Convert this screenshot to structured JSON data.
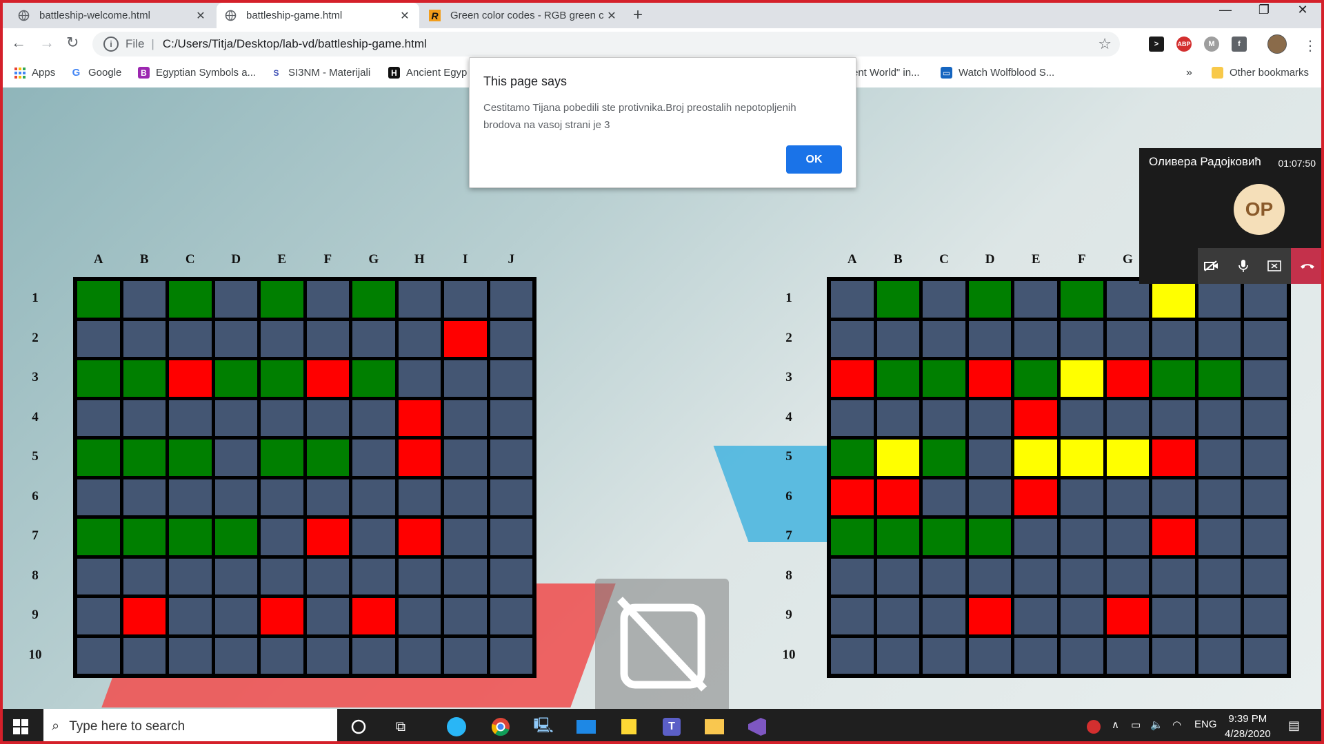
{
  "browser": {
    "tabs": [
      {
        "title": "battleship-welcome.html",
        "active": false
      },
      {
        "title": "battleship-game.html",
        "active": true
      },
      {
        "title": "Green color codes - RGB green c",
        "active": false
      }
    ],
    "address": {
      "scheme_label": "File",
      "url": "C:/Users/Titja/Desktop/lab-vd/battleship-game.html"
    },
    "bookmarks": [
      {
        "label": "Apps"
      },
      {
        "label": "Google"
      },
      {
        "label": "Egyptian Symbols a..."
      },
      {
        "label": "SI3NM - Materijali"
      },
      {
        "label": "Ancient Egyp"
      },
      {
        "label": "ent World\" in..."
      },
      {
        "label": "Watch Wolfblood S..."
      }
    ],
    "bookmarks_overflow": "»",
    "other_bookmarks": "Other bookmarks"
  },
  "dialog": {
    "title": "This page says",
    "message": "Cestitamo Tijana pobedili ste protivnika.Broj preostalih nepotopljenih brodova na vasoj strani je 3",
    "ok_label": "OK"
  },
  "call": {
    "name": "Оливера Радојковић",
    "time": "01:07:50",
    "initials": "OP"
  },
  "game": {
    "col_labels": [
      "A",
      "B",
      "C",
      "D",
      "E",
      "F",
      "G",
      "H",
      "I",
      "J"
    ],
    "row_labels": [
      "1",
      "2",
      "3",
      "4",
      "5",
      "6",
      "7",
      "8",
      "9",
      "10"
    ],
    "colors": {
      "B": "#445673",
      "G": "#007f00",
      "R": "#ff0000",
      "Y": "#ffff00"
    },
    "left_board": [
      "GBGBGBGBBB",
      "BBBBBBBBRB",
      "GGRGGRGBBB",
      "BBBBBBBRBB",
      "GGGBGGBRBB",
      "BBBBBBBBBB",
      "GGGGBRBRBB",
      "BBBBBBBBBB",
      "BRBBRBRBBB",
      "BBBBBBBBBB"
    ],
    "right_board": [
      "BGBGBGBYBB",
      "BBBBBBBBBB",
      "RGGRGYRGGB",
      "BBBBRBBBBB",
      "GYGBYYYRBB",
      "RRBBRBBBBB",
      "GGGGBBBRBB",
      "BBBBBBBBBB",
      "BBBRBBRBBB",
      "BBBBBBBBBB"
    ]
  },
  "taskbar": {
    "search_placeholder": "Type here to search",
    "language": "ENG",
    "time": "9:39 PM",
    "date": "4/28/2020"
  }
}
